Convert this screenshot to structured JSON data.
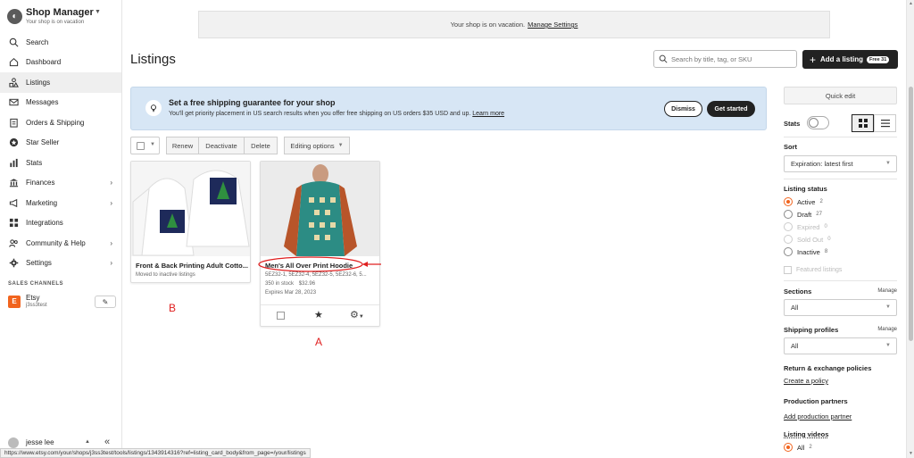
{
  "shop": {
    "title": "Shop Manager",
    "subtitle": "Your shop is on vacation",
    "logo_icon": "shop-logo-icon"
  },
  "nav": [
    {
      "label": "Search",
      "icon": "search-icon"
    },
    {
      "label": "Dashboard",
      "icon": "home-icon"
    },
    {
      "label": "Listings",
      "icon": "listings-icon",
      "active": true
    },
    {
      "label": "Messages",
      "icon": "mail-icon"
    },
    {
      "label": "Orders & Shipping",
      "icon": "clipboard-icon"
    },
    {
      "label": "Star Seller",
      "icon": "star-badge-icon"
    },
    {
      "label": "Stats",
      "icon": "bar-chart-icon"
    },
    {
      "label": "Finances",
      "icon": "bank-icon",
      "chevron": true
    },
    {
      "label": "Marketing",
      "icon": "megaphone-icon",
      "chevron": true
    },
    {
      "label": "Integrations",
      "icon": "grid-icon"
    },
    {
      "label": "Community & Help",
      "icon": "people-icon",
      "chevron": true
    },
    {
      "label": "Settings",
      "icon": "gear-icon",
      "chevron": true
    }
  ],
  "sales_channels": {
    "heading": "SALES CHANNELS",
    "badge": "E",
    "name": "Etsy",
    "shop": "j3ss3test"
  },
  "user": {
    "name": "jesse lee"
  },
  "status_url": "https://www.etsy.com/your/shops/j3ss3test/tools/listings/1343914316?ref=listing_card_body&from_page=/your/listings",
  "vacation": {
    "text": "Your shop is on vacation.",
    "link": "Manage Settings"
  },
  "page": {
    "title": "Listings"
  },
  "search": {
    "placeholder": "Search by title, tag, or SKU"
  },
  "add_listing": {
    "label": "Add a listing",
    "badge": "Free 31"
  },
  "banner": {
    "title": "Set a free shipping guarantee for your shop",
    "text": "You'll get priority placement in US search results when you offer free shipping on US orders $35 USD and up.",
    "link": "Learn more",
    "dismiss": "Dismiss",
    "cta": "Get started"
  },
  "toolbar": {
    "renew": "Renew",
    "deactivate": "Deactivate",
    "delete": "Delete",
    "editing": "Editing options"
  },
  "cards": [
    {
      "title": "Front & Back Printing Adult Cotto...",
      "note": "Moved to inactive listings",
      "annotation": "B"
    },
    {
      "title": "Men's All Over Print Hoodie",
      "skus": "5EZ32-1, 5EZ32-4, 5EZ32-5, 5EZ32-6, 5...",
      "stock": "350 in stock",
      "price": "$32.96",
      "expires": "Expires Mar 28, 2023",
      "annotation": "A"
    }
  ],
  "right": {
    "quick_edit": "Quick edit",
    "stats": "Stats",
    "sort": {
      "label": "Sort",
      "value": "Expiration: latest first"
    },
    "listing_status": {
      "label": "Listing status",
      "options": [
        {
          "label": "Active",
          "count": "2",
          "selected": true
        },
        {
          "label": "Draft",
          "count": "27"
        },
        {
          "label": "Expired",
          "count": "0",
          "disabled": true
        },
        {
          "label": "Sold Out",
          "count": "0",
          "disabled": true
        },
        {
          "label": "Inactive",
          "count": "8"
        }
      ],
      "featured": "Featured listings"
    },
    "sections": {
      "label": "Sections",
      "manage": "Manage",
      "value": "All"
    },
    "shipping": {
      "label": "Shipping profiles",
      "manage": "Manage",
      "value": "All"
    },
    "returns": {
      "label": "Return & exchange policies",
      "link": "Create a policy"
    },
    "production": {
      "label": "Production partners",
      "link": "Add production partner"
    },
    "videos": {
      "label": "Listing videos",
      "option": "All",
      "count": "2"
    }
  },
  "colors": {
    "accent": "#f1641e",
    "annotation": "#e02020",
    "banner_bg": "#d7e6f5"
  }
}
